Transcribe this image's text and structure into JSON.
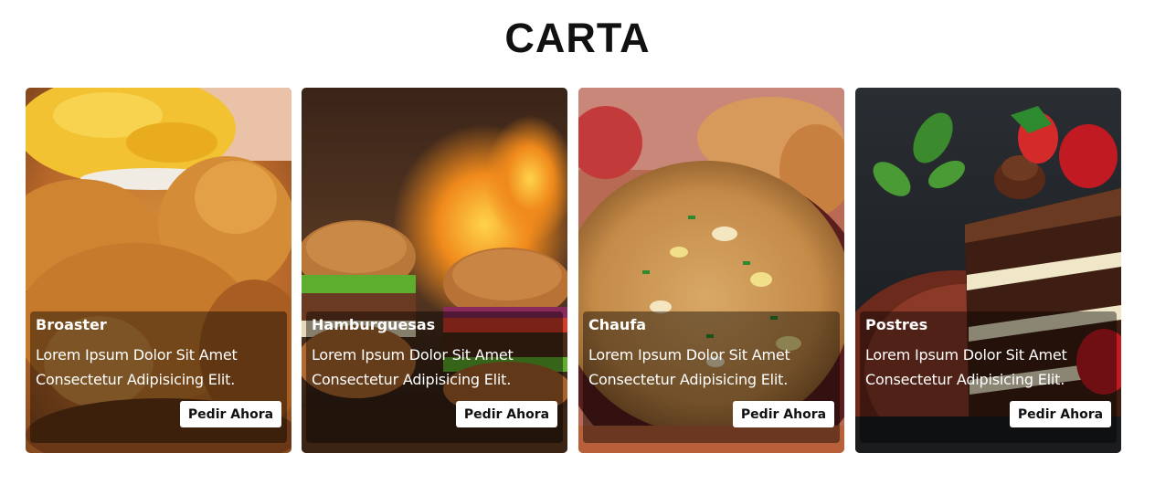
{
  "section": {
    "title": "CARTA"
  },
  "cards": [
    {
      "title": "Broaster",
      "description": "Lorem Ipsum Dolor Sit Amet Consectetur Adipisicing Elit.",
      "button_label": "Pedir Ahora",
      "image": "fried-chicken-photo"
    },
    {
      "title": "Hamburguesas",
      "description": "Lorem Ipsum Dolor Sit Amet Consectetur Adipisicing Elit.",
      "button_label": "Pedir Ahora",
      "image": "burgers-photo"
    },
    {
      "title": "Chaufa",
      "description": "Lorem Ipsum Dolor Sit Amet Consectetur Adipisicing Elit.",
      "button_label": "Pedir Ahora",
      "image": "fried-rice-photo"
    },
    {
      "title": "Postres",
      "description": "Lorem Ipsum Dolor Sit Amet Consectetur Adipisicing Elit.",
      "button_label": "Pedir Ahora",
      "image": "chocolate-cake-photo"
    }
  ]
}
